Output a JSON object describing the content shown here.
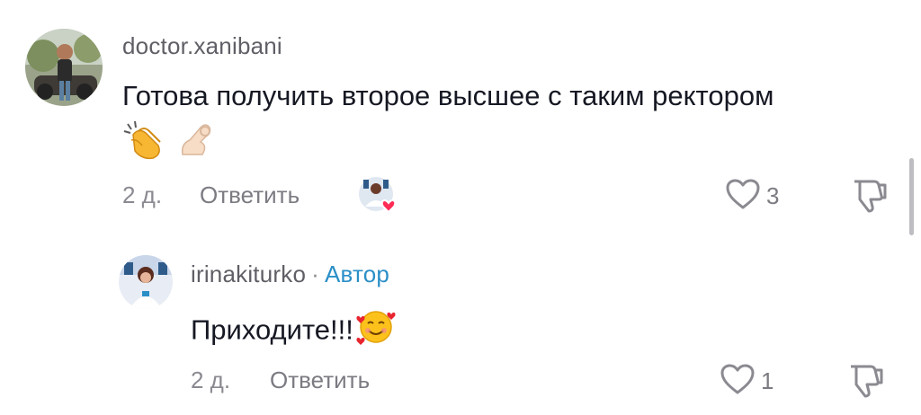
{
  "comments": [
    {
      "username": "doctor.xanibani",
      "text": "Готова получить второе высшее с таким ректором",
      "emojis": [
        "clapping-hands-icon",
        "ok-hand-icon"
      ],
      "time": "2 д.",
      "reply_label": "Ответить",
      "liked_by_author": true,
      "like_count": "3"
    },
    {
      "username": "irinakiturko",
      "separator": "·",
      "author_badge": "Автор",
      "text": "Приходите!!!",
      "emojis": [
        "smiling-face-with-hearts-icon"
      ],
      "time": "2 д.",
      "reply_label": "Ответить",
      "like_count": "1"
    }
  ],
  "colors": {
    "author_badge": "#2b8fc7",
    "text": "#161823",
    "muted": "#8a8a91",
    "heart": "#fe2c55"
  }
}
